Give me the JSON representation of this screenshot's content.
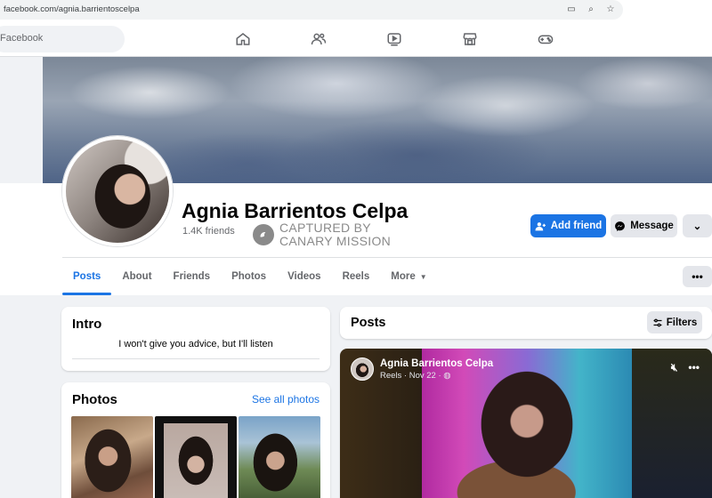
{
  "browser": {
    "url": "facebook.com/agnia.barrientoscelpa"
  },
  "topnav": {
    "search_placeholder": "Facebook"
  },
  "profile": {
    "name": "Agnia Barrientos Celpa",
    "friends": "1.4K friends",
    "watermark_line1": "CAPTURED BY",
    "watermark_line2": "CANARY MISSION",
    "add_friend_label": "Add friend",
    "message_label": "Message"
  },
  "tabs": [
    "Posts",
    "About",
    "Friends",
    "Photos",
    "Videos",
    "Reels",
    "More"
  ],
  "intro": {
    "title": "Intro",
    "bio": "I won't give you advice, but I'll listen"
  },
  "photos": {
    "title": "Photos",
    "see_all": "See all photos"
  },
  "posts": {
    "title": "Posts",
    "filters_label": "Filters"
  },
  "reel": {
    "author": "Agnia Barrientos Celpa",
    "meta": "Reels · Nov 22 ·"
  },
  "colors": {
    "accent": "#1b74e4",
    "background": "#f0f2f5"
  }
}
